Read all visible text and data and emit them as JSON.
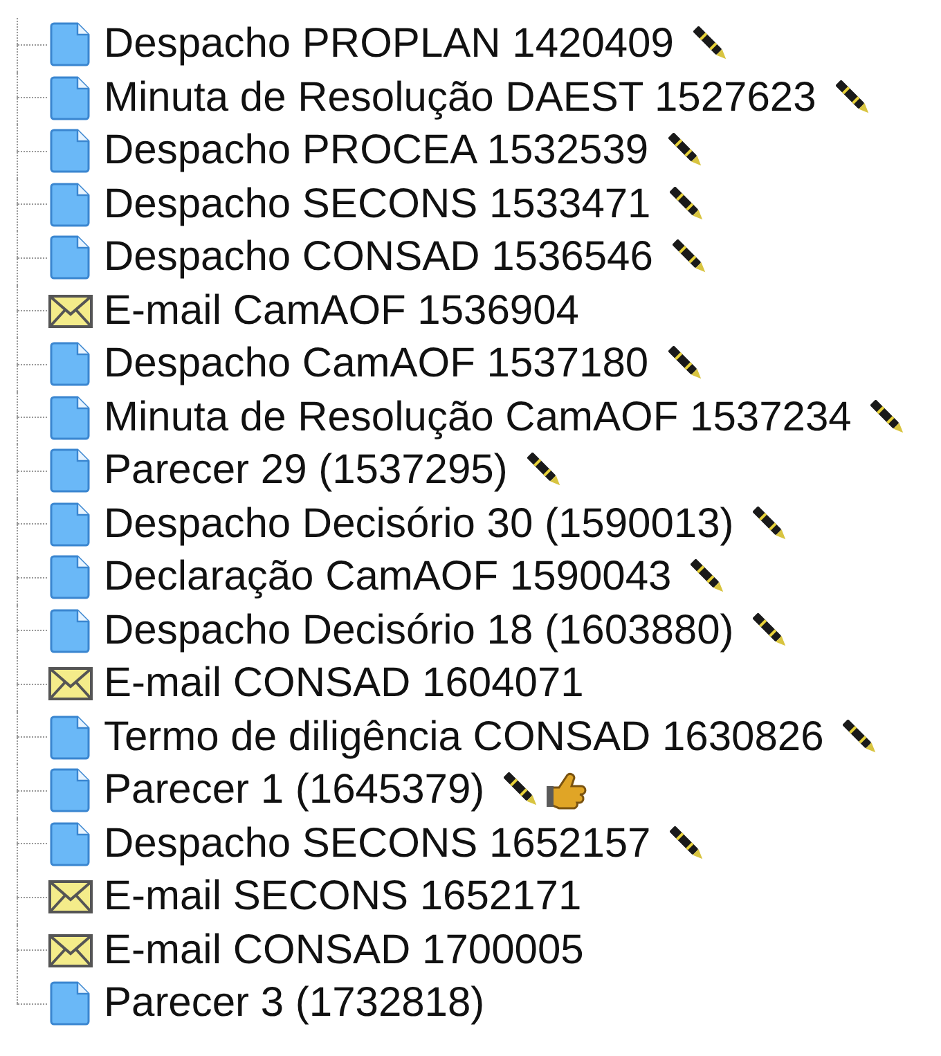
{
  "tree": {
    "items": [
      {
        "kind": "document",
        "label": "Despacho PROPLAN 1420409",
        "signed": true,
        "pointer": false
      },
      {
        "kind": "document",
        "label": "Minuta de Resolução DAEST 1527623",
        "signed": true,
        "pointer": false
      },
      {
        "kind": "document",
        "label": "Despacho PROCEA 1532539",
        "signed": true,
        "pointer": false
      },
      {
        "kind": "document",
        "label": "Despacho SECONS 1533471",
        "signed": true,
        "pointer": false
      },
      {
        "kind": "document",
        "label": "Despacho CONSAD 1536546",
        "signed": true,
        "pointer": false
      },
      {
        "kind": "email",
        "label": "E-mail CamAOF 1536904",
        "signed": false,
        "pointer": false
      },
      {
        "kind": "document",
        "label": "Despacho CamAOF 1537180",
        "signed": true,
        "pointer": false
      },
      {
        "kind": "document",
        "label": "Minuta de Resolução CamAOF 1537234",
        "signed": true,
        "pointer": false
      },
      {
        "kind": "document",
        "label": "Parecer 29 (1537295)",
        "signed": true,
        "pointer": false
      },
      {
        "kind": "document",
        "label": "Despacho Decisório 30 (1590013)",
        "signed": true,
        "pointer": false
      },
      {
        "kind": "document",
        "label": "Declaração CamAOF 1590043",
        "signed": true,
        "pointer": false
      },
      {
        "kind": "document",
        "label": "Despacho Decisório 18 (1603880)",
        "signed": true,
        "pointer": false
      },
      {
        "kind": "email",
        "label": "E-mail CONSAD 1604071",
        "signed": false,
        "pointer": false
      },
      {
        "kind": "document",
        "label": "Termo de diligência CONSAD 1630826",
        "signed": true,
        "pointer": false
      },
      {
        "kind": "document",
        "label": "Parecer 1 (1645379)",
        "signed": true,
        "pointer": true
      },
      {
        "kind": "document",
        "label": "Despacho SECONS 1652157",
        "signed": true,
        "pointer": false
      },
      {
        "kind": "email",
        "label": "E-mail SECONS 1652171",
        "signed": false,
        "pointer": false
      },
      {
        "kind": "email",
        "label": "E-mail CONSAD 1700005",
        "signed": false,
        "pointer": false
      },
      {
        "kind": "document",
        "label": "Parecer 3 (1732818)",
        "signed": false,
        "pointer": false
      }
    ]
  }
}
